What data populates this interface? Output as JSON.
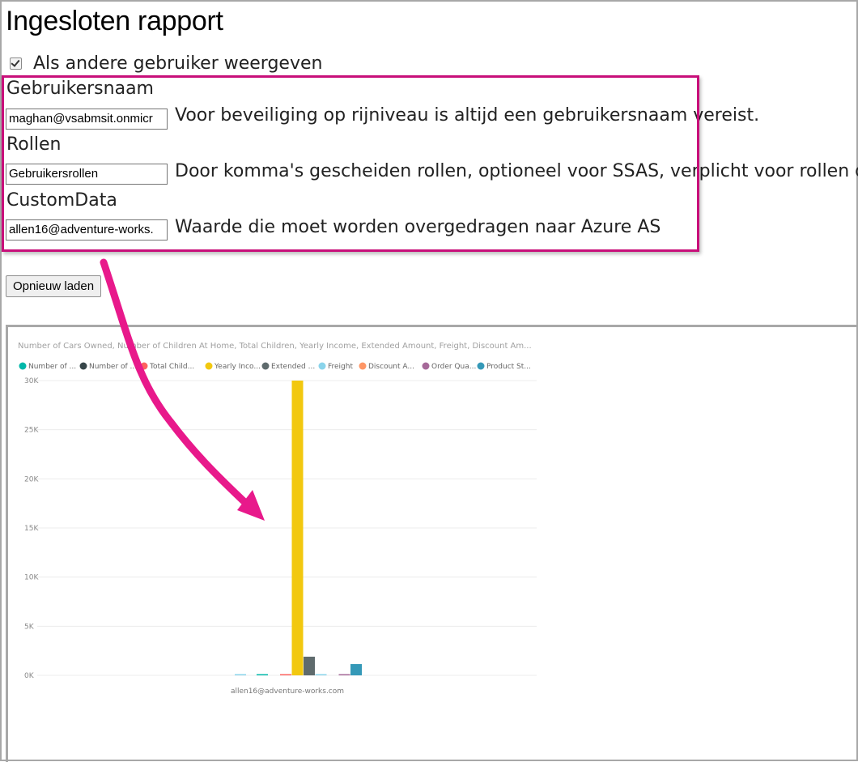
{
  "page": {
    "title": "Ingesloten rapport",
    "view_as_label": "Als andere gebruiker weergeven",
    "view_as_checked": true
  },
  "form": {
    "username": {
      "label": "Gebruikersnaam",
      "value": "maghan@vsabmsit.onmicr",
      "hint": "Voor beveiliging op rijniveau is altijd een gebruikersnaam vereist."
    },
    "roles": {
      "label": "Rollen",
      "value": "Gebruikersrollen",
      "hint": "Door komma's gescheiden rollen, optioneel voor SSAS, verplicht voor rollen die..."
    },
    "custom_data": {
      "label": "CustomData",
      "value": "allen16@adventure-works.",
      "hint": "Waarde die moet worden overgedragen naar Azure AS"
    },
    "reload_label": "Opnieuw laden"
  },
  "colors": {
    "highlight": "#c80f7a",
    "arrow": "#e8198b"
  },
  "chart_data": {
    "type": "bar",
    "title": "Number of Cars Owned, Number of Children At Home, Total Children, Yearly Income, Extended Amount, Freight, Discount Am...",
    "categories": [
      "allen16@adventure-works.com"
    ],
    "series": [
      {
        "name": "Number of ...",
        "color": "#01b8aa",
        "values": [
          2
        ]
      },
      {
        "name": "Number of ...",
        "color": "#374649",
        "values": [
          0
        ]
      },
      {
        "name": "Total Child...",
        "color": "#fd625e",
        "values": [
          2
        ]
      },
      {
        "name": "Yearly Inco...",
        "color": "#f2c80f",
        "values": [
          30000
        ]
      },
      {
        "name": "Extended ...",
        "color": "#5f6b6d",
        "values": [
          1900
        ]
      },
      {
        "name": "Freight",
        "color": "#8ad4eb",
        "values": [
          50
        ]
      },
      {
        "name": "Discount A...",
        "color": "#fe9666",
        "values": [
          0
        ]
      },
      {
        "name": "Order Qua...",
        "color": "#a66999",
        "values": [
          8
        ]
      },
      {
        "name": "Product St...",
        "color": "#3599b8",
        "values": [
          1150
        ]
      }
    ],
    "extra_marks_left": [
      {
        "color": "#8ad4eb",
        "value": 60
      }
    ],
    "ylim": [
      0,
      30000
    ],
    "yticks": [
      0,
      5000,
      10000,
      15000,
      20000,
      25000,
      30000
    ],
    "ytick_labels": [
      "0K",
      "5K",
      "10K",
      "15K",
      "20K",
      "25K",
      "30K"
    ],
    "grid": true,
    "legend_position": "top-left"
  }
}
